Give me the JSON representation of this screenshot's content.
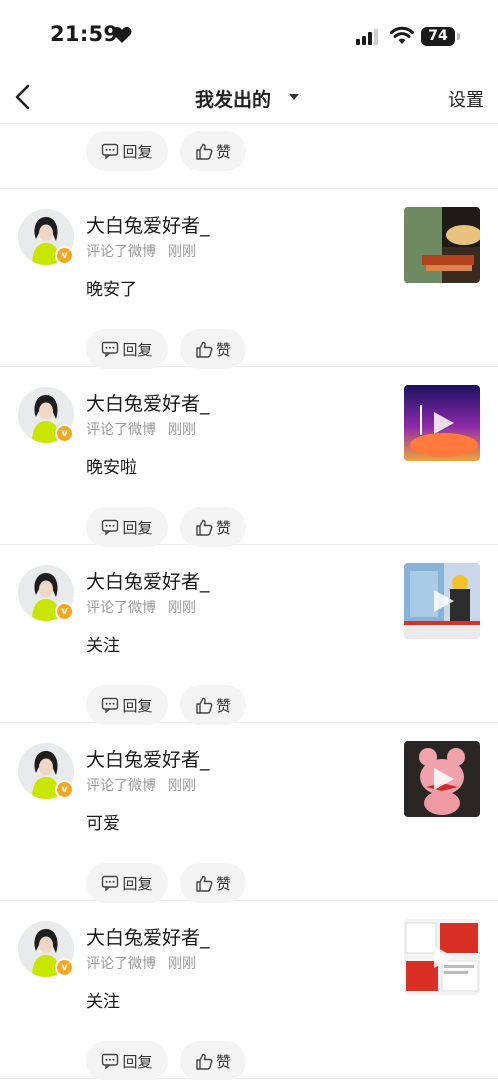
{
  "status_bar": {
    "time": "21:59",
    "battery": "74"
  },
  "nav": {
    "title": "我发出的",
    "settings": "设置"
  },
  "actions": {
    "reply": "回复",
    "like": "赞"
  },
  "items": [
    {
      "username": "大白兔爱好者_",
      "action": "评论了微博",
      "time": "刚刚",
      "content": "晚安了",
      "thumb": "thumbnail-image"
    },
    {
      "username": "大白兔爱好者_",
      "action": "评论了微博",
      "time": "刚刚",
      "content": "晚安啦",
      "thumb": "video-thumbnail"
    },
    {
      "username": "大白兔爱好者_",
      "action": "评论了微博",
      "time": "刚刚",
      "content": "关注",
      "thumb": "video-thumbnail"
    },
    {
      "username": "大白兔爱好者_",
      "action": "评论了微博",
      "time": "刚刚",
      "content": "可爱",
      "thumb": "video-thumbnail"
    },
    {
      "username": "大白兔爱好者_",
      "action": "评论了微博",
      "time": "刚刚",
      "content": "关注",
      "thumb": "video-thumbnail"
    }
  ],
  "colors": {
    "badge": "#f5a623",
    "avatar_accent": "#c8e600"
  }
}
